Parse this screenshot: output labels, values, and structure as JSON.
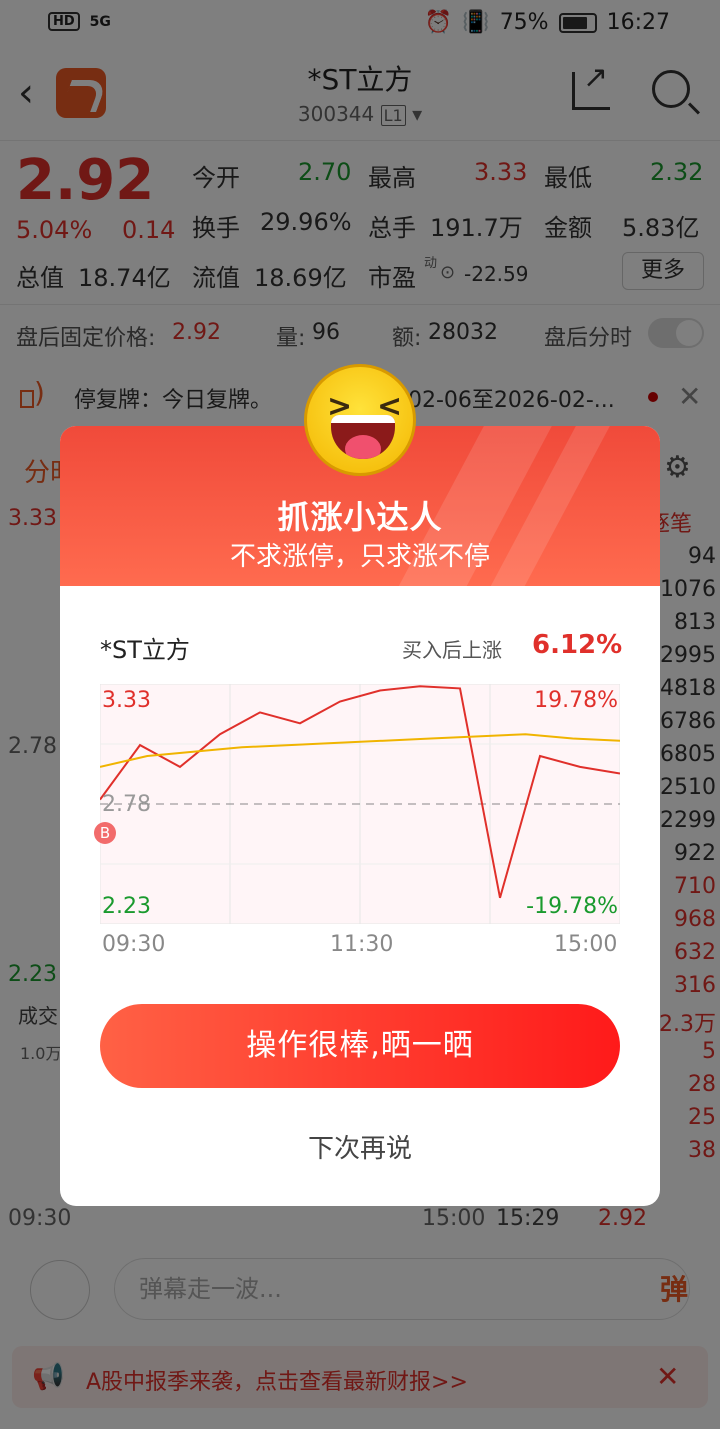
{
  "status_bar": {
    "left": "5G",
    "hd": "HD",
    "battery": "75%",
    "time": "16:27"
  },
  "header": {
    "stock_name": "*ST立方",
    "stock_code": "300344",
    "level": "L1"
  },
  "quote": {
    "price": "2.92",
    "pct_change": "5.04%",
    "change": "0.14",
    "open_label": "今开",
    "open": "2.70",
    "high_label": "最高",
    "high": "3.33",
    "low_label": "最低",
    "low": "2.32",
    "turnover_label": "换手",
    "turnover": "29.96%",
    "volume_label": "总手",
    "volume": "191.7万",
    "amount_label": "金额",
    "amount": "5.83亿",
    "total_cap_label": "总值",
    "total_cap": "18.74亿",
    "float_cap_label": "流值",
    "float_cap": "18.69亿",
    "pe_label": "市盈",
    "pe_sup": "动",
    "pe": "-22.59",
    "more": "更多"
  },
  "after_hours": {
    "label": "盘后固定价格:",
    "price": "2.92",
    "vol_label": "量:",
    "vol": "96",
    "amt_label": "额:",
    "amt": "28032",
    "toggle_label": "盘后分时"
  },
  "notice": {
    "text": "停复牌：今日复牌。",
    "date_range": "02-06至2026-02-..."
  },
  "background": {
    "tab": "分时",
    "left_axis": [
      "3.33",
      "2.78",
      "2.23"
    ],
    "vol_label": "成交",
    "vol_top": "1.0万",
    "time_start": "09:30",
    "time_end": "15:00",
    "right_header": "逐笔",
    "right_values": [
      "94",
      "1076",
      "813",
      "2995",
      "4818",
      "6786",
      "6805",
      "2510",
      "2299",
      "922",
      "710",
      "968",
      "632",
      "316",
      "2.3万",
      "5",
      "28",
      "25",
      "38"
    ],
    "last_time": "15:29",
    "last_price": "2.92"
  },
  "bottom": {
    "danmu_placeholder": "弹幕走一波...",
    "danmu_btn": "弹"
  },
  "banner": {
    "text": "A股中报季来袭，点击查看最新财报>>"
  },
  "modal": {
    "title": "抓涨小达人",
    "subtitle": "不求涨停，只求涨不停",
    "stock": "*ST立方",
    "gain_label": "买入后上涨",
    "gain": "6.12%",
    "y_high": "3.33",
    "y_mid": "2.78",
    "y_low": "2.23",
    "pct_high": "19.78%",
    "pct_low": "-19.78%",
    "x_start": "09:30",
    "x_mid": "11:30",
    "x_end": "15:00",
    "buy_marker": "B",
    "share_button": "操作很棒,晒一晒",
    "later": "下次再说"
  },
  "chart_data": {
    "type": "line",
    "title": "",
    "x": [
      "09:30",
      "11:30",
      "15:00"
    ],
    "ylim": [
      2.23,
      3.33
    ],
    "ref_line": 2.78,
    "series": [
      {
        "values": [
          2.8,
          3.05,
          2.95,
          3.1,
          3.2,
          3.15,
          3.25,
          3.3,
          3.32,
          3.31,
          2.35,
          3.0,
          2.95,
          2.92
        ]
      },
      {
        "values": [
          2.95,
          3.0,
          3.02,
          3.04,
          3.05,
          3.06,
          3.07,
          3.08,
          3.09,
          3.1,
          3.08,
          3.07
        ]
      }
    ]
  },
  "colors": {
    "up": "#e0302b",
    "down": "#1a9a2e",
    "accent": "#ff4a2b"
  }
}
